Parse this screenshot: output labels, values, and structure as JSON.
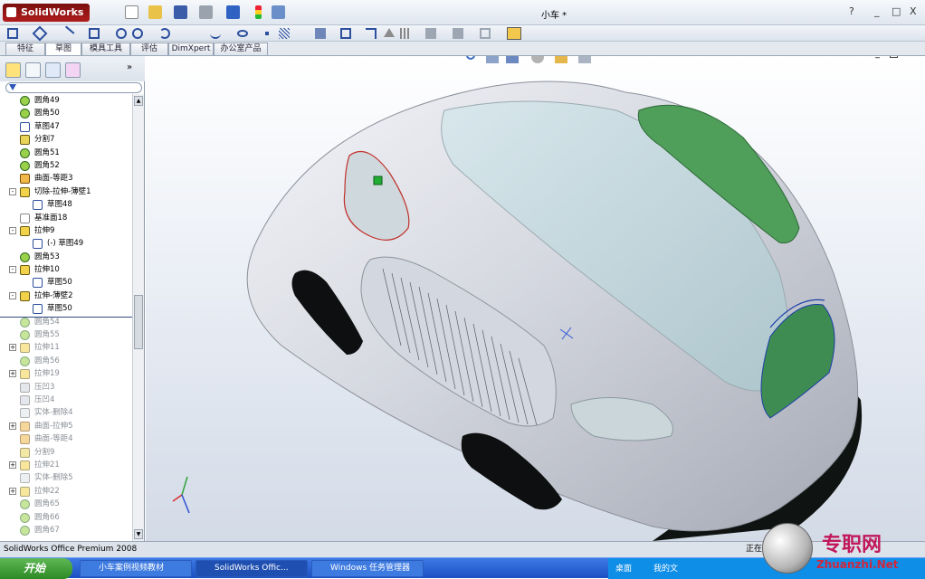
{
  "app": {
    "logo": "SolidWorks",
    "doc_title": "小车 *",
    "help": "?",
    "min": "_",
    "max": "□",
    "close": "X"
  },
  "tabs": [
    "特征",
    "草图",
    "模具工具",
    "评估",
    "DimXpert",
    "办公室产品"
  ],
  "tree": [
    {
      "label": "圆角49",
      "icon": "fillet",
      "pm": ""
    },
    {
      "label": "圆角50",
      "icon": "fillet",
      "pm": ""
    },
    {
      "label": "草图47",
      "icon": "sketch",
      "pm": ""
    },
    {
      "label": "分割7",
      "icon": "split",
      "pm": ""
    },
    {
      "label": "圆角51",
      "icon": "fillet",
      "pm": ""
    },
    {
      "label": "圆角52",
      "icon": "fillet",
      "pm": ""
    },
    {
      "label": "曲面-等距3",
      "icon": "surface",
      "pm": ""
    },
    {
      "label": "切除-拉伸-薄壁1",
      "icon": "cut",
      "pm": "-"
    },
    {
      "label": "草图48",
      "icon": "sketch",
      "pm": "",
      "indent": 1
    },
    {
      "label": "基准面18",
      "icon": "plane",
      "pm": ""
    },
    {
      "label": "拉伸9",
      "icon": "extrude",
      "pm": "-"
    },
    {
      "label": "(-) 草图49",
      "icon": "sketch",
      "pm": "",
      "indent": 1
    },
    {
      "label": "圆角53",
      "icon": "fillet",
      "pm": ""
    },
    {
      "label": "拉伸10",
      "icon": "extrude",
      "pm": "-"
    },
    {
      "label": "草图50",
      "icon": "sketch",
      "pm": "",
      "indent": 1
    },
    {
      "label": "拉伸-薄壁2",
      "icon": "extrude",
      "pm": "-"
    },
    {
      "label": "草图50",
      "icon": "sketch",
      "pm": "",
      "indent": 1
    },
    {
      "label": "圆角54",
      "icon": "fillet",
      "pm": "",
      "dim": true
    },
    {
      "label": "圆角55",
      "icon": "fillet",
      "pm": "",
      "dim": true
    },
    {
      "label": "拉伸11",
      "icon": "extrude",
      "pm": "+",
      "dim": true
    },
    {
      "label": "圆角56",
      "icon": "fillet",
      "pm": "",
      "dim": true
    },
    {
      "label": "拉伸19",
      "icon": "extrude",
      "pm": "+",
      "dim": true
    },
    {
      "label": "压凹3",
      "icon": "indent",
      "pm": "",
      "dim": true
    },
    {
      "label": "压凹4",
      "icon": "indent",
      "pm": "",
      "dim": true
    },
    {
      "label": "实体-删除4",
      "icon": "delete",
      "pm": "",
      "dim": true
    },
    {
      "label": "曲面-拉伸5",
      "icon": "surface",
      "pm": "+",
      "dim": true
    },
    {
      "label": "曲面-等距4",
      "icon": "surface",
      "pm": "",
      "dim": true
    },
    {
      "label": "分割9",
      "icon": "split",
      "pm": "",
      "dim": true
    },
    {
      "label": "拉伸21",
      "icon": "extrude",
      "pm": "+",
      "dim": true
    },
    {
      "label": "实体-删除5",
      "icon": "delete",
      "pm": "",
      "dim": true
    },
    {
      "label": "拉伸22",
      "icon": "extrude",
      "pm": "+",
      "dim": true
    },
    {
      "label": "圆角65",
      "icon": "fillet",
      "pm": "",
      "dim": true
    },
    {
      "label": "圆角66",
      "icon": "fillet",
      "pm": "",
      "dim": true
    },
    {
      "label": "圆角67",
      "icon": "fillet",
      "pm": "",
      "dim": true
    }
  ],
  "status": {
    "left": "SolidWorks Office Premium 2008",
    "right": "正在"
  },
  "taskbar": {
    "start": "开始",
    "items": [
      "小车案例视频教材",
      "SolidWorks Offic...",
      "Windows 任务管理器"
    ],
    "tray_a": "桌面",
    "tray_b": "我的文"
  },
  "watermark": {
    "cn": "专职网",
    "en": "Zhuanzhi.Net"
  },
  "colors": {
    "accent": "#3c6fd6",
    "glass": "#5ea865"
  }
}
